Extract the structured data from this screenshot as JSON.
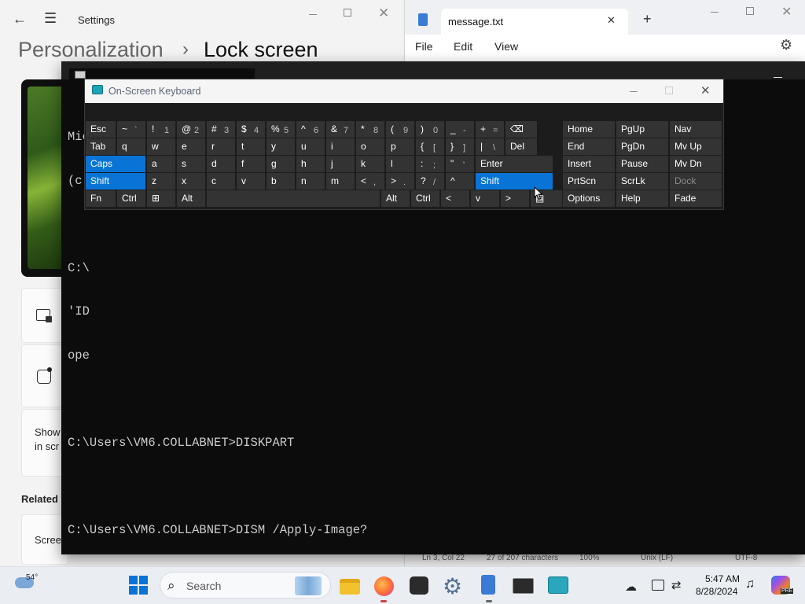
{
  "settings": {
    "app_title": "Settings",
    "bc_parent": "Personalization",
    "bc_sep": "›",
    "bc_current": "Lock screen",
    "row3_line1": "Show",
    "row3_line2": "in scr",
    "related": "Related",
    "screen_item": "Scree"
  },
  "notepad": {
    "tab": "message.txt",
    "menu_file": "File",
    "menu_edit": "Edit",
    "menu_view": "View",
    "status": [
      "Ln 3, Col 22",
      "27 of 207 characters",
      "100%",
      "Unix (LF)",
      "UTF-8"
    ]
  },
  "cmd": {
    "partial_lines": [
      "Mic",
      "(c)",
      "C:\\",
      "'ID",
      "ope"
    ],
    "line_diskpart": "C:\\Users\\VM6.COLLABNET>DISKPART",
    "line_dism": "C:\\Users\\VM6.COLLABNET>DISM /Apply-Image?"
  },
  "osk": {
    "title": "On-Screen Keyboard",
    "row1": [
      {
        "m": "Esc"
      },
      {
        "m": "~",
        "s": "`"
      },
      {
        "m": "!",
        "s": "1"
      },
      {
        "m": "@",
        "s": "2"
      },
      {
        "m": "#",
        "s": "3"
      },
      {
        "m": "$",
        "s": "4"
      },
      {
        "m": "%",
        "s": "5"
      },
      {
        "m": "^",
        "s": "6"
      },
      {
        "m": "&",
        "s": "7"
      },
      {
        "m": "*",
        "s": "8"
      },
      {
        "m": "(",
        "s": "9"
      },
      {
        "m": ")",
        "s": "0"
      },
      {
        "m": "_",
        "s": "-"
      },
      {
        "m": "+",
        "s": "="
      },
      {
        "m": "⌫"
      }
    ],
    "row2": [
      {
        "m": "Tab"
      },
      {
        "m": "q"
      },
      {
        "m": "w"
      },
      {
        "m": "e"
      },
      {
        "m": "r"
      },
      {
        "m": "t"
      },
      {
        "m": "y"
      },
      {
        "m": "u"
      },
      {
        "m": "i"
      },
      {
        "m": "o"
      },
      {
        "m": "p"
      },
      {
        "m": "{",
        "s": "["
      },
      {
        "m": "}",
        "s": "]"
      },
      {
        "m": "|",
        "s": "\\"
      },
      {
        "m": "Del"
      }
    ],
    "row3": [
      {
        "m": "Caps"
      },
      {
        "m": "a"
      },
      {
        "m": "s"
      },
      {
        "m": "d"
      },
      {
        "m": "f"
      },
      {
        "m": "g"
      },
      {
        "m": "h"
      },
      {
        "m": "j"
      },
      {
        "m": "k"
      },
      {
        "m": "l"
      },
      {
        "m": ":",
        "s": ";"
      },
      {
        "m": "\"",
        "s": "'"
      },
      {
        "m": "Enter"
      }
    ],
    "row4": [
      {
        "m": "Shift"
      },
      {
        "m": "z"
      },
      {
        "m": "x"
      },
      {
        "m": "c"
      },
      {
        "m": "v"
      },
      {
        "m": "b"
      },
      {
        "m": "n"
      },
      {
        "m": "m"
      },
      {
        "m": "<",
        "s": ","
      },
      {
        "m": ">",
        "s": "."
      },
      {
        "m": "?",
        "s": "/"
      },
      {
        "m": "^"
      },
      {
        "m": "Shift"
      }
    ],
    "row5": [
      {
        "m": "Fn"
      },
      {
        "m": "Ctrl"
      },
      {
        "m": "⊞"
      },
      {
        "m": "Alt"
      },
      {
        "m": ""
      },
      {
        "m": "Alt"
      },
      {
        "m": "Ctrl"
      },
      {
        "m": "<"
      },
      {
        "m": "v"
      },
      {
        "m": ">"
      },
      {
        "m": "▤"
      }
    ],
    "side": [
      [
        "Home",
        "PgUp",
        "Nav"
      ],
      [
        "End",
        "PgDn",
        "Mv Up"
      ],
      [
        "Insert",
        "Pause",
        "Mv Dn"
      ],
      [
        "PrtScn",
        "ScrLk",
        "Dock"
      ],
      [
        "Options",
        "Help",
        "Fade"
      ]
    ]
  },
  "taskbar": {
    "temp": "54°",
    "search_placeholder": "Search",
    "time": "5:47 AM",
    "date": "8/28/2024",
    "pre_badge": "PRE"
  },
  "colors": {
    "accent": "#0a74d6",
    "console_bg": "#0c0c0c",
    "key_bg": "#333333"
  }
}
